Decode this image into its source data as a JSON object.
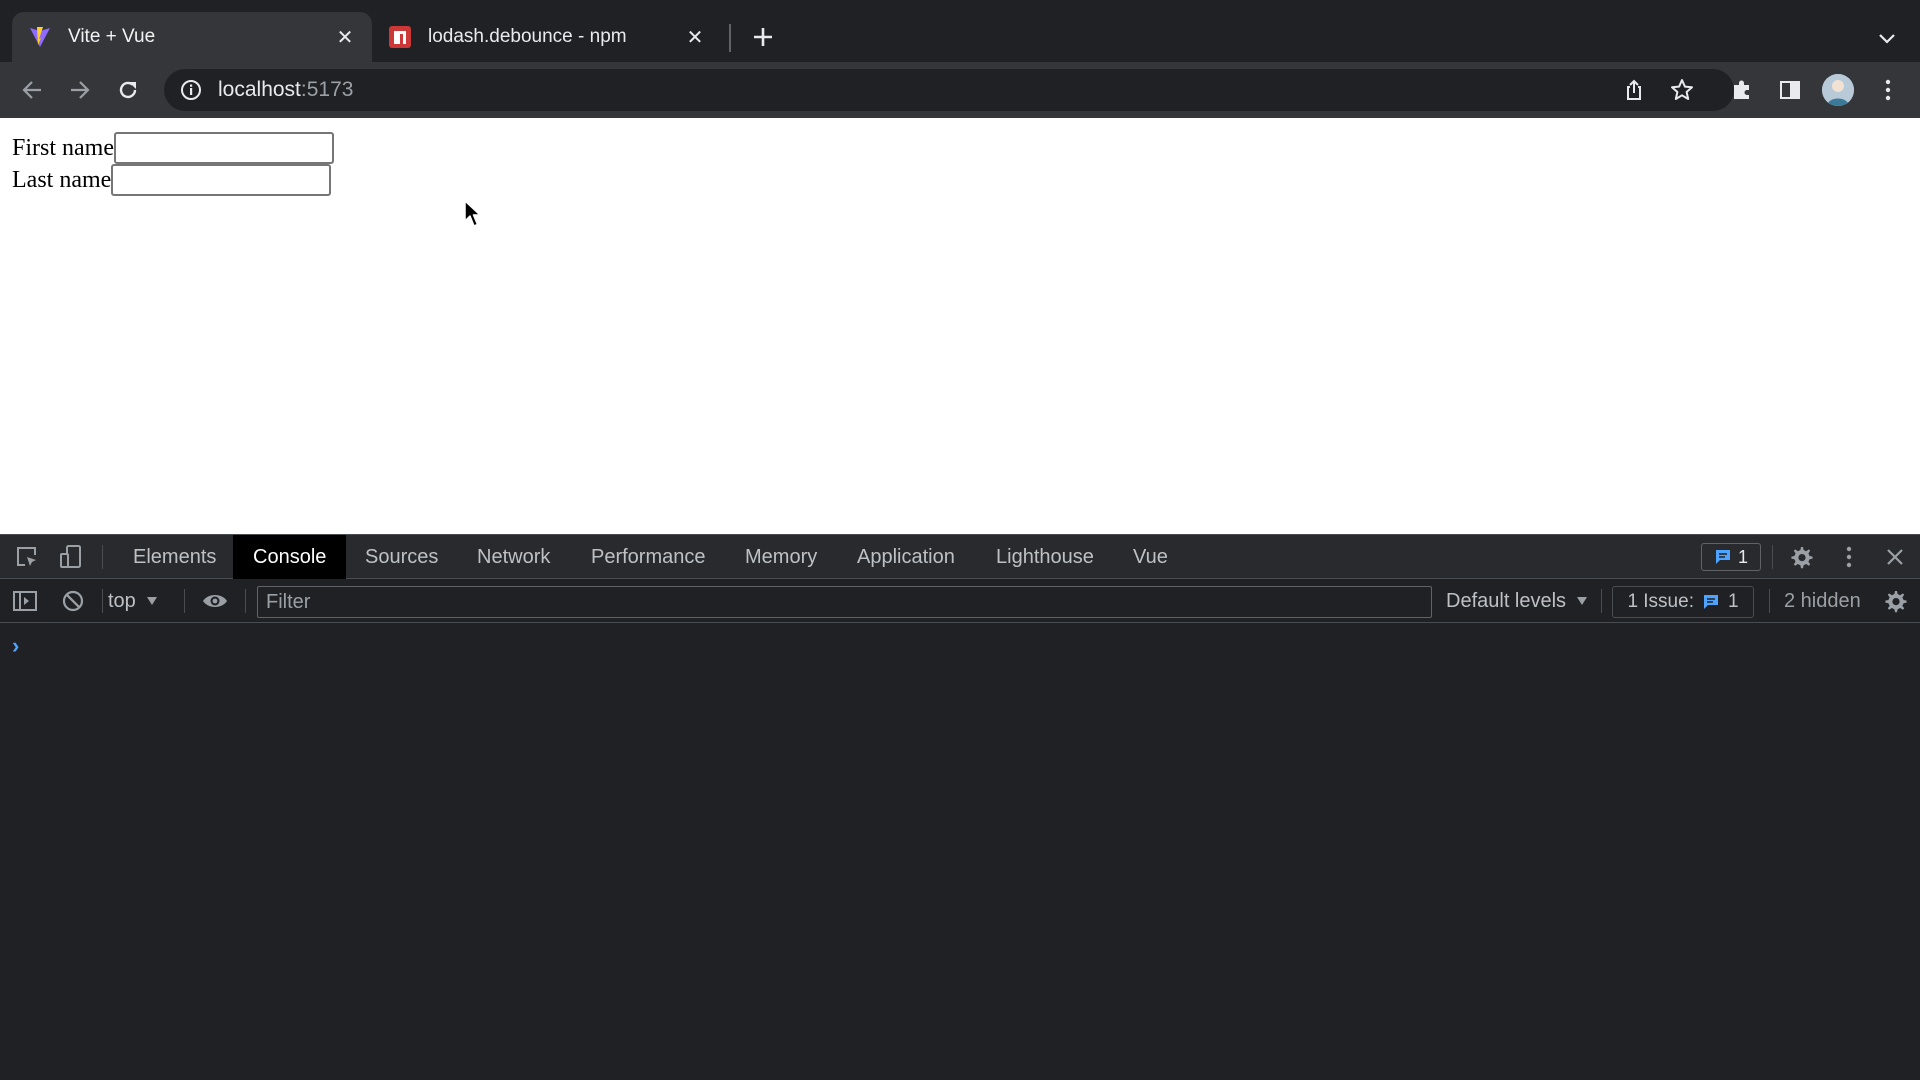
{
  "browser": {
    "tabs": [
      {
        "title": "Vite + Vue",
        "favicon": "vite-logo-icon",
        "active": true
      },
      {
        "title": "lodash.debounce - npm",
        "favicon": "npm-logo-icon",
        "active": false
      }
    ],
    "address_bar": {
      "host": "localhost",
      "port": ":5173"
    }
  },
  "page": {
    "fields": [
      {
        "label": "First name",
        "value": ""
      },
      {
        "label": "Last name",
        "value": ""
      }
    ]
  },
  "devtools": {
    "tabs": [
      "Elements",
      "Console",
      "Sources",
      "Network",
      "Performance",
      "Memory",
      "Application",
      "Lighthouse",
      "Vue"
    ],
    "active_tab": "Console",
    "issue_badge_count": "1",
    "console": {
      "context": "top",
      "filter_placeholder": "Filter",
      "levels": "Default levels",
      "issues_label": "1 Issue:",
      "issues_count": "1",
      "hidden_label": "2 hidden"
    }
  },
  "colors": {
    "vite_purple": "#8f6bff",
    "vite_yellow": "#ffd028",
    "npm_red": "#cb3837",
    "devtools_accent": "#4da3ff"
  }
}
